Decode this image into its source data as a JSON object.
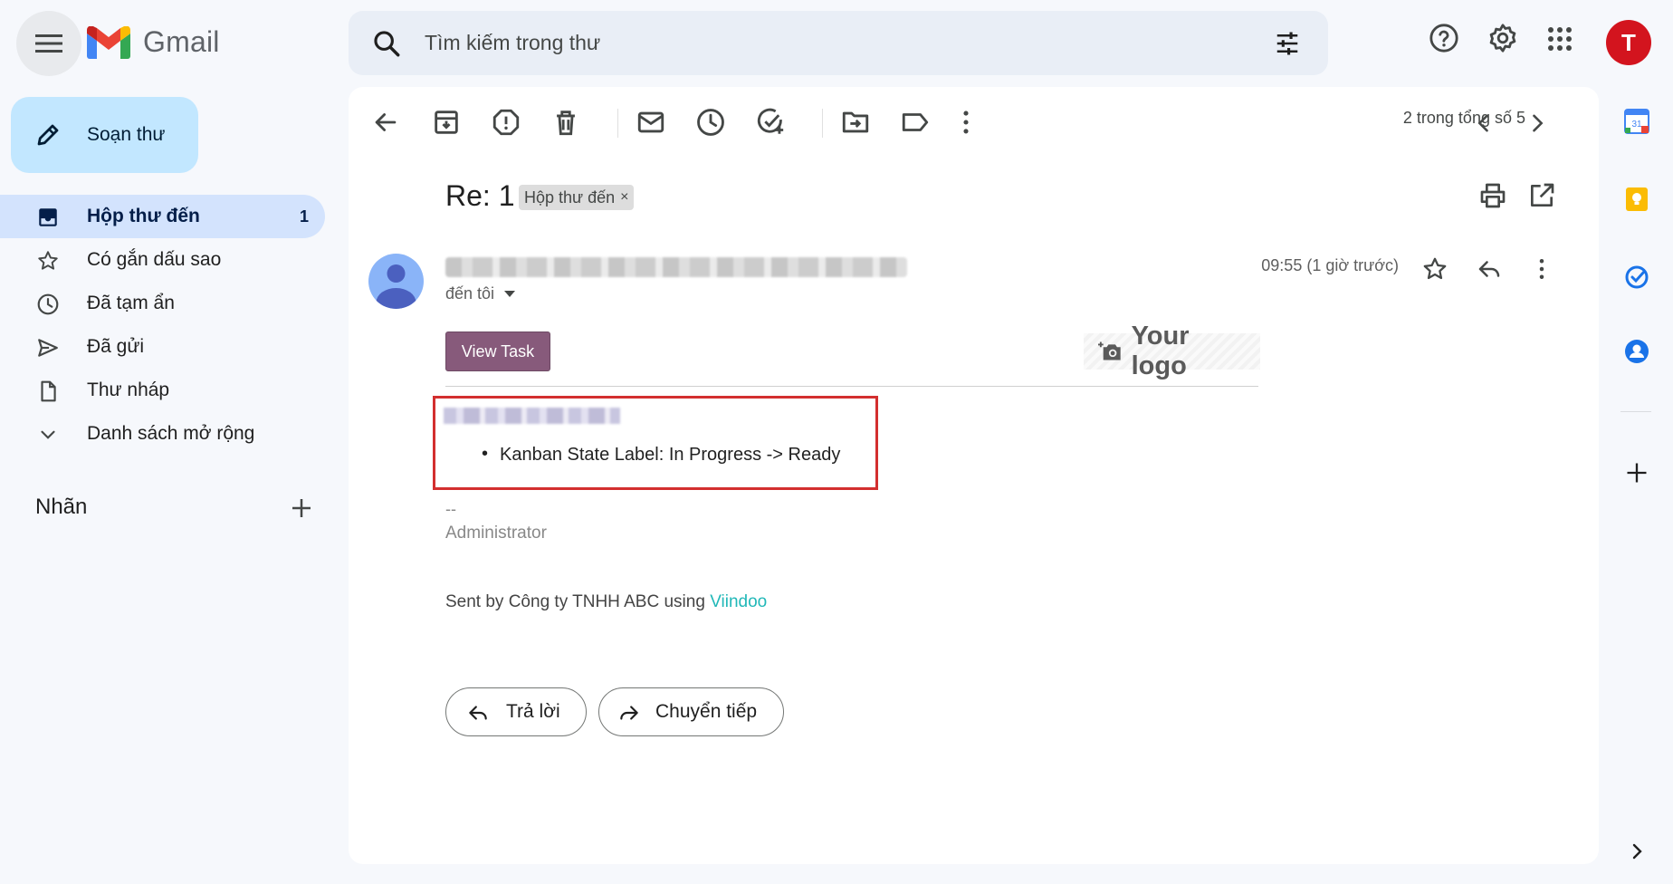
{
  "app": {
    "name": "Gmail"
  },
  "search": {
    "placeholder": "Tìm kiếm trong thư"
  },
  "user": {
    "initial": "T",
    "avatar_color": "#d3141e"
  },
  "compose": {
    "label": "Soạn thư"
  },
  "sidebar": {
    "items": [
      {
        "label": "Hộp thư đến",
        "count": "1",
        "icon": "inbox-icon",
        "active": true
      },
      {
        "label": "Có gắn dấu sao",
        "icon": "star-icon"
      },
      {
        "label": "Đã tạm ẩn",
        "icon": "clock-icon"
      },
      {
        "label": "Đã gửi",
        "icon": "send-icon"
      },
      {
        "label": "Thư nháp",
        "icon": "draft-icon"
      },
      {
        "label": "Danh sách mở rộng",
        "icon": "chevron-down-icon"
      }
    ],
    "labels_title": "Nhãn"
  },
  "toolbar": {
    "pager": "2 trong tổng số 5"
  },
  "message": {
    "subject": "Re: 1",
    "tag": "Hộp thư đến",
    "tag_remove": "×",
    "to": "đến tôi",
    "time": "09:55 (1 giờ trước)",
    "view_task": "View Task",
    "logo_text": "Your logo",
    "bullet": "Kanban State Label: In Progress -> Ready",
    "sig_dash": "--",
    "sig_name": "Administrator",
    "sent_by_prefix": "Sent by Công ty TNHH ABC using",
    "sent_by_link": "Viindoo"
  },
  "actions": {
    "reply": "Trả lời",
    "forward": "Chuyển tiếp"
  },
  "colors": {
    "accent": "#c2e7ff",
    "active_nav": "#d3e3fd",
    "view_task_button": "#875a7b",
    "link": "#21b8b8",
    "highlight_border": "#d32f2f"
  }
}
